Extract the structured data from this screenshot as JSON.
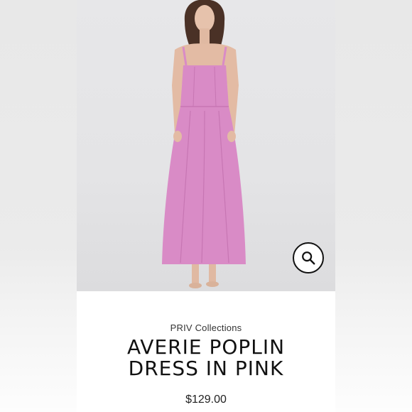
{
  "product": {
    "brand": "PRIV Collections",
    "title_line1": "AVERIE POPLIN",
    "title_line2": "DRESS IN PINK",
    "price": "$129.00",
    "image_alt": "Model wearing pink poplin midi dress",
    "dress_color": "#d98bc6"
  },
  "icons": {
    "zoom": "search-icon"
  },
  "colors": {
    "background": "#ffffff",
    "text": "#111111",
    "dress": "#d98bc6"
  }
}
